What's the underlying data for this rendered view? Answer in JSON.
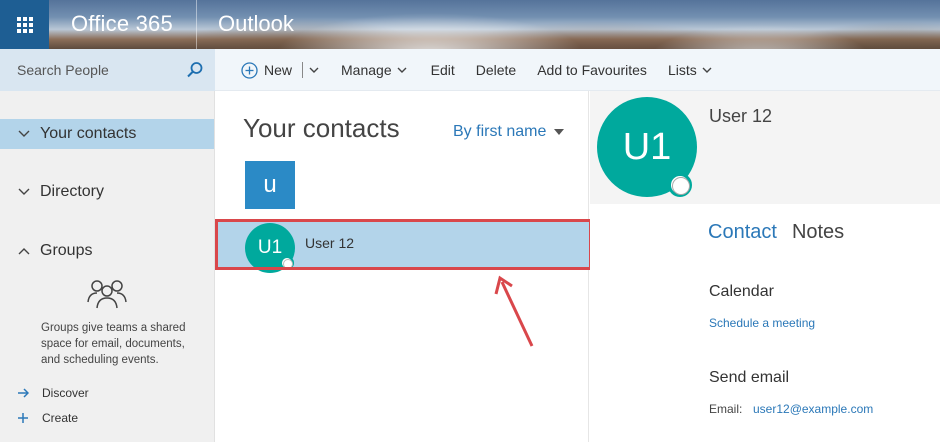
{
  "header": {
    "brand": "Office 365",
    "app": "Outlook"
  },
  "search": {
    "placeholder": "Search People"
  },
  "toolbar": {
    "new_label": "New",
    "manage_label": "Manage",
    "edit_label": "Edit",
    "delete_label": "Delete",
    "add_fav_label": "Add to Favourites",
    "lists_label": "Lists"
  },
  "sidebar": {
    "items": [
      {
        "label": "Your contacts",
        "selected": true
      },
      {
        "label": "Directory",
        "selected": false
      },
      {
        "label": "Groups",
        "selected": false
      }
    ],
    "groups_description": "Groups give teams a shared space for email, documents, and scheduling events.",
    "discover_label": "Discover",
    "create_label": "Create"
  },
  "list": {
    "title": "Your contacts",
    "sort_label": "By first name",
    "group_letter": "u",
    "contacts": [
      {
        "initials": "U1",
        "name": "User 12"
      }
    ]
  },
  "detail": {
    "initials": "U1",
    "name": "User 12",
    "tabs": [
      {
        "label": "Contact",
        "active": true
      },
      {
        "label": "Notes",
        "active": false
      }
    ],
    "calendar_title": "Calendar",
    "schedule_link": "Schedule a meeting",
    "send_email_title": "Send email",
    "email_label": "Email:",
    "email": "user12@example.com"
  },
  "colors": {
    "suite_blue": "#1e5e93",
    "selected_bg": "#b3d4ea",
    "accent_link": "#2b78b8",
    "avatar_teal": "#00a99d",
    "letter_tile": "#2b8ac6",
    "highlight_red": "#d9474b"
  }
}
